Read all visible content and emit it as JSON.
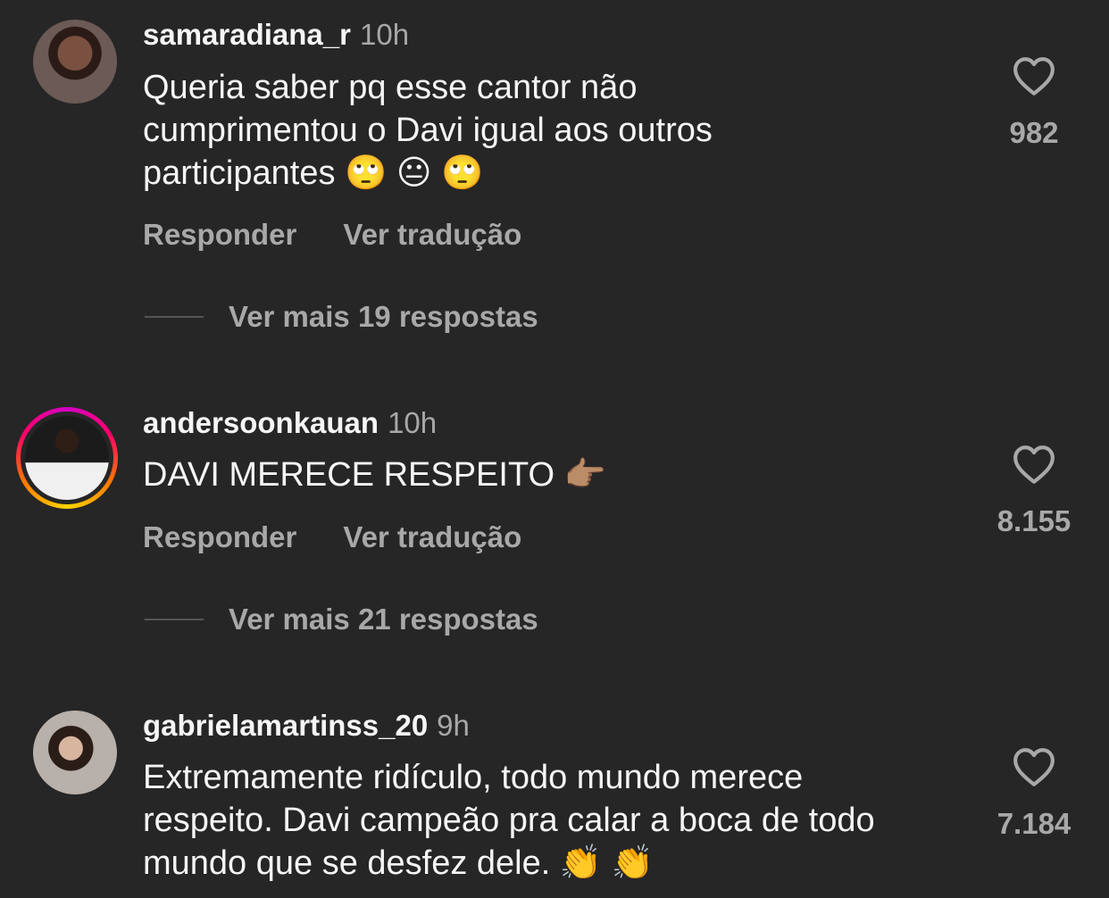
{
  "comments": [
    {
      "username": "samaradiana_r",
      "time": "10h",
      "text": "Queria saber pq esse cantor não cumprimentou o Davi igual aos outros participantes 🙄 😐 🙄",
      "reply_label": "Responder",
      "translate_label": "Ver tradução",
      "more_replies": "Ver mais 19 respostas",
      "likes": "982",
      "has_story_ring": false
    },
    {
      "username": "andersoonkauan",
      "time": "10h",
      "text": "DAVI MERECE RESPEITO 👉🏽",
      "reply_label": "Responder",
      "translate_label": "Ver tradução",
      "more_replies": "Ver mais 21 respostas",
      "likes": "8.155",
      "has_story_ring": true
    },
    {
      "username": "gabrielamartinss_20",
      "time": "9h",
      "text": "Extremamente ridículo, todo mundo merece respeito. Davi campeão pra calar a boca de todo mundo que se desfez dele. 👏 👏",
      "likes": "7.184",
      "has_story_ring": false
    }
  ],
  "icons": {
    "like": "heart-outline-icon"
  },
  "colors": {
    "background": "#262626",
    "text": "#f5f5f5",
    "secondary": "#a8a8a8"
  }
}
